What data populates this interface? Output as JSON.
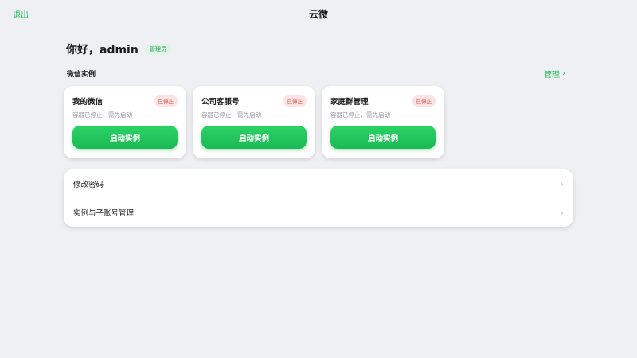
{
  "topbar": {
    "logout_label": "退出",
    "title": "云微"
  },
  "greeting": {
    "text": "你好，admin",
    "role_badge": "管理员"
  },
  "instances": {
    "section_title": "微信实例",
    "manage_label": "管理",
    "manage_chevron": "›",
    "cards": [
      {
        "name": "我的微信",
        "status": "已停止",
        "desc": "容器已停止，需先启动",
        "button": "启动实例"
      },
      {
        "name": "公司客服号",
        "status": "已停止",
        "desc": "容器已停止，需先启动",
        "button": "启动实例"
      },
      {
        "name": "家庭群管理",
        "status": "已停止",
        "desc": "容器已停止，需先启动",
        "button": "启动实例"
      }
    ]
  },
  "menu": {
    "items": [
      {
        "label": "修改密码",
        "chevron": "›"
      },
      {
        "label": "实例与子账号管理",
        "chevron": "›"
      }
    ]
  },
  "colors": {
    "accent": "#1fb954",
    "status_stopped": "#e04848",
    "background": "#eff0f4"
  }
}
